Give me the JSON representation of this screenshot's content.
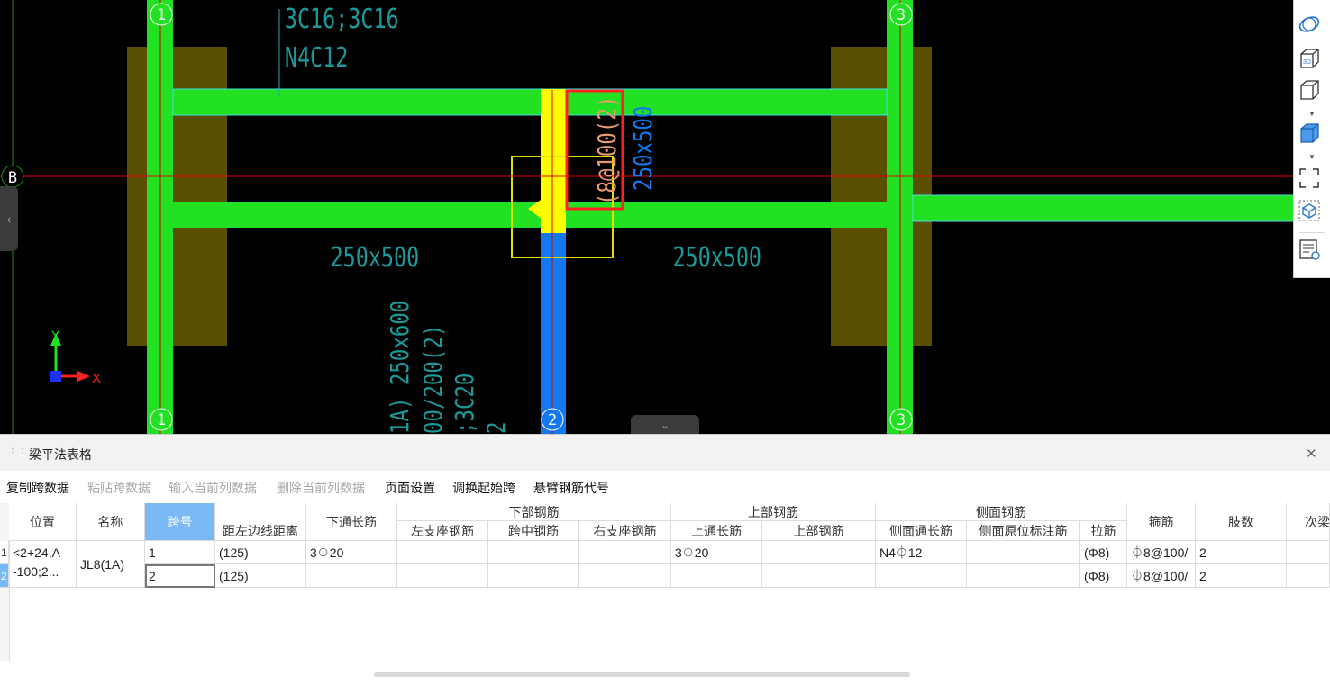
{
  "canvas": {
    "axes": {
      "top_1": "1",
      "top_3": "3",
      "left_B": "B",
      "bottom_1": "1",
      "bottom_2": "2",
      "bottom_3": "3"
    },
    "annotations": {
      "rebar_top_line1": "3C16;3C16",
      "rebar_top_line2": "N4C12",
      "beam_size_left": "250x500",
      "beam_size_right": "250x500",
      "stirrup_vertical": "(8@100(2)",
      "beam_size_vertical": "250x500",
      "bottom_line1": "1A) 250x600",
      "bottom_line2": "00/200(2)",
      "bottom_line3": ";3C20",
      "bottom_line4": "2"
    },
    "ucs": {
      "x_label": "X",
      "y_label": "Y"
    },
    "colors": {
      "beam": "#22e022",
      "column": "#5a4f00",
      "selected_beam": "#1478f0",
      "highlight": "#ffff00",
      "axis_line": "#e00000"
    }
  },
  "toolbar": {
    "icons": [
      "orbit-icon",
      "view-3d-icon",
      "box-view-icon",
      "solid-cube-icon",
      "fullscreen-icon",
      "dashed-cube-icon",
      "layer-list-icon"
    ]
  },
  "panel": {
    "title": "梁平法表格",
    "menu": [
      {
        "label": "复制跨数据",
        "enabled": true
      },
      {
        "label": "粘贴跨数据",
        "enabled": false
      },
      {
        "label": "输入当前列数据",
        "enabled": false
      },
      {
        "label": "删除当前列数据",
        "enabled": false
      },
      {
        "label": "页面设置",
        "enabled": true
      },
      {
        "label": "调换起始跨",
        "enabled": true
      },
      {
        "label": "悬臂钢筋代号",
        "enabled": true
      }
    ],
    "headers": {
      "position": "位置",
      "name": "名称",
      "span_no": "跨号",
      "dist_left_edge": "距左边线距离",
      "bottom_through": "下通长筋",
      "bottom_rebar": "下部钢筋",
      "left_support": "左支座钢筋",
      "mid_span": "跨中钢筋",
      "right_support": "右支座钢筋",
      "top_rebar_group": "上部钢筋",
      "top_through": "上通长筋",
      "top_rebar": "上部钢筋",
      "side_rebar_group": "侧面钢筋",
      "side_through": "侧面通长筋",
      "side_in_situ": "侧面原位标注筋",
      "tie_bar": "拉筋",
      "stirrup": "箍筋",
      "legs": "肢数",
      "secondary": "次梁"
    },
    "rows": [
      {
        "row_no": "1",
        "position": "<2+24,A",
        "name": "JL8(1A)",
        "span_no": "1",
        "dist": "(125)",
        "bottom_through": "3⏀20",
        "left_support": "",
        "mid_span": "",
        "right_support": "",
        "top_through": "3⏀20",
        "top_rebar": "",
        "side_through": "N4⏀12",
        "side_in_situ": "",
        "tie_bar": "(Φ8)",
        "stirrup": "⏀8@100/",
        "legs": "2",
        "secondary": ""
      },
      {
        "row_no": "2",
        "position": "-100;2...",
        "name": "",
        "span_no": "2",
        "dist": "(125)",
        "bottom_through": "",
        "left_support": "",
        "mid_span": "",
        "right_support": "",
        "top_through": "",
        "top_rebar": "",
        "side_through": "",
        "side_in_situ": "",
        "tie_bar": "(Φ8)",
        "stirrup": "⏀8@100/",
        "legs": "2",
        "secondary": ""
      }
    ]
  }
}
